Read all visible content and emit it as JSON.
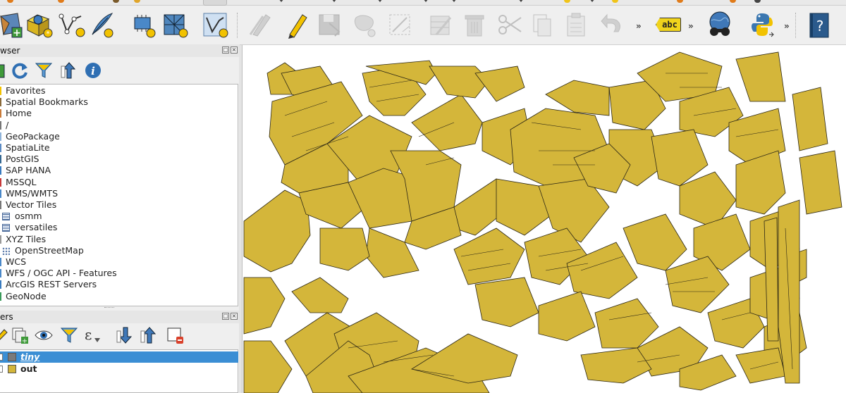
{
  "colors": {
    "building_fill": "#d4b63a",
    "building_stroke": "#2b2615",
    "layer_tiny": "#7a7a7a",
    "layer_out": "#d4b63a",
    "selection": "#3b8ed4"
  },
  "toolbar": {
    "abc_label": "abc",
    "help_label": "?",
    "overflow_1": "»",
    "overflow_2": "»",
    "overflow_3": "»"
  },
  "browser_panel": {
    "title": "wser",
    "items": [
      {
        "label": "Favorites",
        "icon": "star-icon"
      },
      {
        "label": "Spatial Bookmarks",
        "icon": "bookmark-icon"
      },
      {
        "label": "Home",
        "icon": "home-icon"
      },
      {
        "label": "/",
        "icon": "root-folder-icon"
      },
      {
        "label": "GeoPackage",
        "icon": "geopackage-icon"
      },
      {
        "label": "SpatiaLite",
        "icon": "spatialite-icon"
      },
      {
        "label": "PostGIS",
        "icon": "postgis-icon"
      },
      {
        "label": "SAP HANA",
        "icon": "saphana-icon"
      },
      {
        "label": "MSSQL",
        "icon": "mssql-icon"
      },
      {
        "label": "WMS/WMTS",
        "icon": "wms-icon"
      },
      {
        "label": "Vector Tiles",
        "icon": "vector-tiles-icon"
      },
      {
        "label": "osmm",
        "icon": "grid-icon",
        "child": true
      },
      {
        "label": "versatiles",
        "icon": "grid-icon",
        "child": true
      },
      {
        "label": "XYZ Tiles",
        "icon": "xyz-icon"
      },
      {
        "label": "OpenStreetMap",
        "icon": "dotgrid-icon",
        "child": true
      },
      {
        "label": "WCS",
        "icon": "wcs-icon"
      },
      {
        "label": "WFS / OGC API - Features",
        "icon": "wfs-icon"
      },
      {
        "label": "ArcGIS REST Servers",
        "icon": "arcgis-icon"
      },
      {
        "label": "GeoNode",
        "icon": "geonode-icon"
      }
    ]
  },
  "layers_panel": {
    "title": "ers",
    "layers": [
      {
        "name": "tiny",
        "selected": true
      },
      {
        "name": "out",
        "selected": false
      }
    ]
  }
}
